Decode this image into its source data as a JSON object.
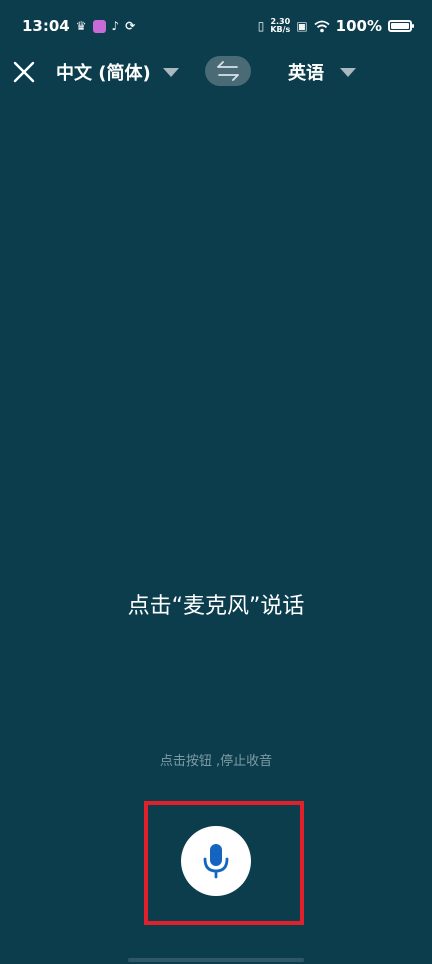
{
  "status_bar": {
    "time": "13:04",
    "net_speed_value": "2.30",
    "net_speed_unit": "KB/s",
    "battery": "100%"
  },
  "toolbar": {
    "source_language": "中文 (简体)",
    "target_language": "英语"
  },
  "main": {
    "prompt": "点击“麦克风”说话",
    "hint": "点击按钮 ,停止收音"
  },
  "colors": {
    "background": "#0b3d4c",
    "swap_pill": "#4a6a76",
    "mic_blue": "#1565c0",
    "highlight_frame": "#e0202a",
    "hint_text": "#7f9aa4"
  }
}
